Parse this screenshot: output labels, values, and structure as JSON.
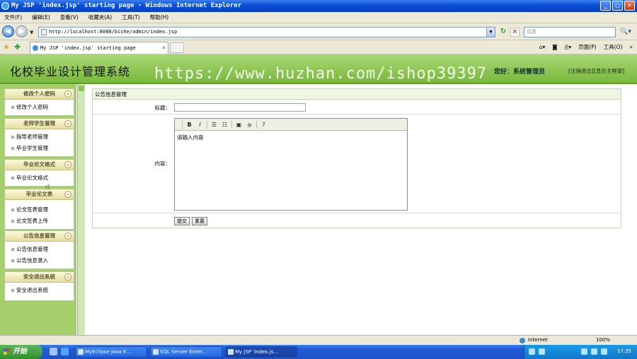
{
  "window": {
    "title": "My JSP 'index.jsp' starting page - Windows Internet Explorer"
  },
  "menu": [
    "文件(F)",
    "编辑(E)",
    "查看(V)",
    "收藏夹(A)",
    "工具(T)",
    "帮助(H)"
  ],
  "address": {
    "url": "http://localhost:8080/bishe/admin/index.jsp"
  },
  "search": {
    "placeholder": "百度"
  },
  "tab": {
    "title": "My JSP 'index.jsp' starting page"
  },
  "commands": {
    "page": "页面(P)",
    "tools": "工具(O)"
  },
  "header": {
    "brand": "化校毕业设计管理系统",
    "watermark": "https://www.huzhan.com/ishop39397",
    "greeting": "您好：系统管理员",
    "links": "[注销退出][显示主框架]"
  },
  "sidebar": {
    "groups": [
      {
        "title": "修改个人密码",
        "items": [
          "修改个人密码"
        ]
      },
      {
        "title": "老师学生管理",
        "items": [
          "指导老师管理",
          "毕业学生管理"
        ]
      },
      {
        "title": "毕业论文格式",
        "items": [
          "毕业论文格式"
        ]
      },
      {
        "title": "毕业论文表",
        "items": [
          "论文签表管理",
          "论文签表上传"
        ]
      },
      {
        "title": "公告信息管理",
        "items": [
          "公告信息管理",
          "公告信息录入"
        ]
      },
      {
        "title": "安全退出系统",
        "items": [
          "安全退出系统"
        ]
      }
    ]
  },
  "content": {
    "heading": "公告信息管理",
    "title_label": "标题：",
    "content_label": "内容：",
    "editor_placeholder": "请输入内容",
    "submit": "提交",
    "reset": "重置"
  },
  "status": {
    "zone": "Internet",
    "zoom": "100%"
  },
  "taskbar": {
    "start": "开始",
    "tasks": [
      "MyEclipse Java E...",
      "SQL Server Enter...",
      "My JSP 'index.js..."
    ],
    "clock": "17:35"
  },
  "colors": {
    "header_green": "#8cc850",
    "sidebar_green": "#a4cf6a",
    "titlebar_blue": "#0a4fd8"
  }
}
